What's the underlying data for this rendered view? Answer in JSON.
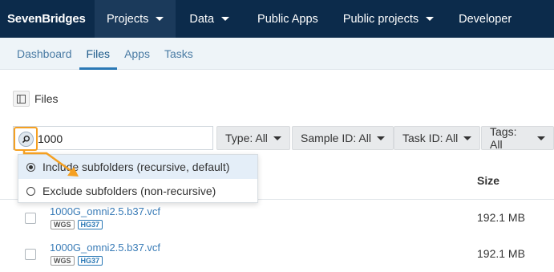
{
  "brand": "SevenBridges",
  "topnav": [
    {
      "label": "Projects",
      "caret": true,
      "active": true
    },
    {
      "label": "Data",
      "caret": true
    },
    {
      "label": "Public Apps",
      "caret": false
    },
    {
      "label": "Public projects",
      "caret": true
    },
    {
      "label": "Developer",
      "caret": false
    }
  ],
  "subnav": [
    {
      "label": "Dashboard"
    },
    {
      "label": "Files",
      "active": true
    },
    {
      "label": "Apps"
    },
    {
      "label": "Tasks"
    }
  ],
  "files": {
    "title": "Files"
  },
  "search": {
    "value": "1000"
  },
  "filters": [
    {
      "label": "Type: All"
    },
    {
      "label": "Sample ID: All"
    },
    {
      "label": "Task ID: All"
    },
    {
      "label": "Tags: All"
    }
  ],
  "dropdown": {
    "options": [
      {
        "label": "Include subfolders (recursive, default)",
        "selected": true
      },
      {
        "label": "Exclude subfolders (non-recursive)",
        "selected": false
      }
    ]
  },
  "table": {
    "size_header": "Size",
    "rows": [
      {
        "name": "1000G_omni2.5.b37.vcf",
        "tags": [
          "WGS",
          "HG37"
        ],
        "size": "192.1 MB"
      },
      {
        "name": "1000G_omni2.5.b37.vcf",
        "tags": [
          "WGS",
          "HG37"
        ],
        "size": "192.1 MB"
      }
    ]
  },
  "colors": {
    "nav_bg": "#0c2b4b",
    "accent": "#2a78b5",
    "annotation": "#f5a021"
  }
}
